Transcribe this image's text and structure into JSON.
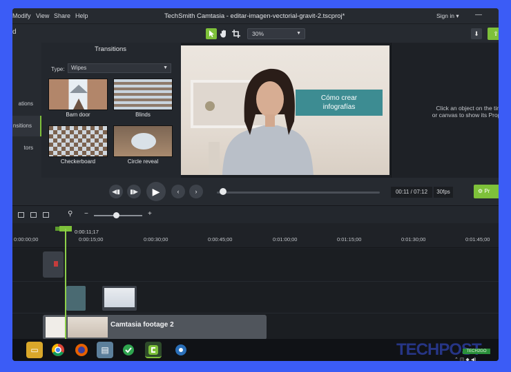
{
  "menubar": {
    "items": [
      "Modify",
      "View",
      "Share",
      "Help"
    ],
    "title": "TechSmith Camtasia - editar-imagen-vectorial-gravit-2.tscproj*",
    "signin": "Sign in ▾",
    "minimize": "—"
  },
  "toolbar": {
    "left_label": "d",
    "select_icon": "arrow-cursor-icon",
    "pan_icon": "hand-icon",
    "crop_icon": "crop-icon",
    "zoom_value": "30%",
    "download_icon": "download-icon",
    "export_icon": "share-icon"
  },
  "leftnav": {
    "items": [
      "ations",
      "nsitions",
      "tors",
      ""
    ]
  },
  "transitions": {
    "title": "Transitions",
    "type_label": "Type:",
    "type_value": "Wipes",
    "items": [
      {
        "label": "Barn door"
      },
      {
        "label": "Blinds"
      },
      {
        "label": "Checkerboard"
      },
      {
        "label": "Circle reveal"
      }
    ]
  },
  "preview": {
    "caption_line1": "Cómo crear",
    "caption_line2": "infografías"
  },
  "properties": {
    "hint_line1": "Click an object on the timel",
    "hint_line2": "or canvas to show its Proper"
  },
  "playback": {
    "timecode": "00:11 / 07:12",
    "fps": "30fps",
    "properties_button": "Pr"
  },
  "timeline": {
    "zoom_minus": "−",
    "zoom_plus": "+",
    "playhead_time": "0:00:11;17",
    "ticks": [
      "0:00:00;00",
      "0:00:15;00",
      "0:00:30;00",
      "0:00:45;00",
      "0:01:00;00",
      "0:01:15;00",
      "0:01:30;00",
      "0:01:45;00"
    ],
    "main_clip_label": "Camtasia footage 2"
  },
  "taskbar": {
    "watermark": "TECHPOST",
    "watermark_sub": "TECH2GO",
    "tray": "⌃ ◫ ◆ ◀)"
  },
  "colors": {
    "accent": "#7ec13a",
    "caption": "#3d8c92",
    "frame_border": "#3b5cf6"
  }
}
